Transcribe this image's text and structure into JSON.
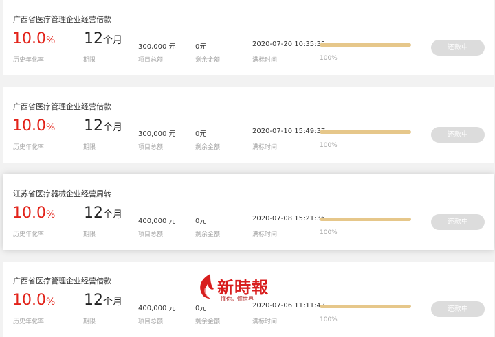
{
  "colors": {
    "rate_red": "#e2231a",
    "progress_gold": "#e6c78a",
    "button_disabled": "#dcdcdc"
  },
  "labels": {
    "rate": "历史年化率",
    "term": "期限",
    "total": "项目总额",
    "remaining": "剩余金额",
    "full_time": "满标时间"
  },
  "loans": [
    {
      "title": "广西省医疗管理企业经营借款",
      "rate_value": "10.0",
      "rate_unit": "%",
      "term_value": "12",
      "term_unit": "个月",
      "total": "300,000 元",
      "remaining": "0元",
      "full_time": "2020-07-20 10:35:35",
      "progress": 100,
      "progress_text": "100%",
      "button_label": "还款中"
    },
    {
      "title": "广西省医疗管理企业经营借款",
      "rate_value": "10.0",
      "rate_unit": "%",
      "term_value": "12",
      "term_unit": "个月",
      "total": "300,000 元",
      "remaining": "0元",
      "full_time": "2020-07-10 15:49:37",
      "progress": 100,
      "progress_text": "100%",
      "button_label": "还款中"
    },
    {
      "title": "江苏省医疗器械企业经营周转",
      "rate_value": "10.0",
      "rate_unit": "%",
      "term_value": "12",
      "term_unit": "个月",
      "total": "400,000 元",
      "remaining": "0元",
      "full_time": "2020-07-08 15:21:36",
      "progress": 100,
      "progress_text": "100%",
      "button_label": "还款中"
    },
    {
      "title": "广西省医疗管理企业经营借款",
      "rate_value": "10.0",
      "rate_unit": "%",
      "term_value": "12",
      "term_unit": "个月",
      "total": "400,000 元",
      "remaining": "0元",
      "full_time": "2020-07-06 11:11:47",
      "progress": 100,
      "progress_text": "100%",
      "button_label": "还款中"
    }
  ],
  "watermark": {
    "name": "新時報",
    "slogan": "懂你，懂世界",
    "icon": "flame-logo-icon"
  }
}
